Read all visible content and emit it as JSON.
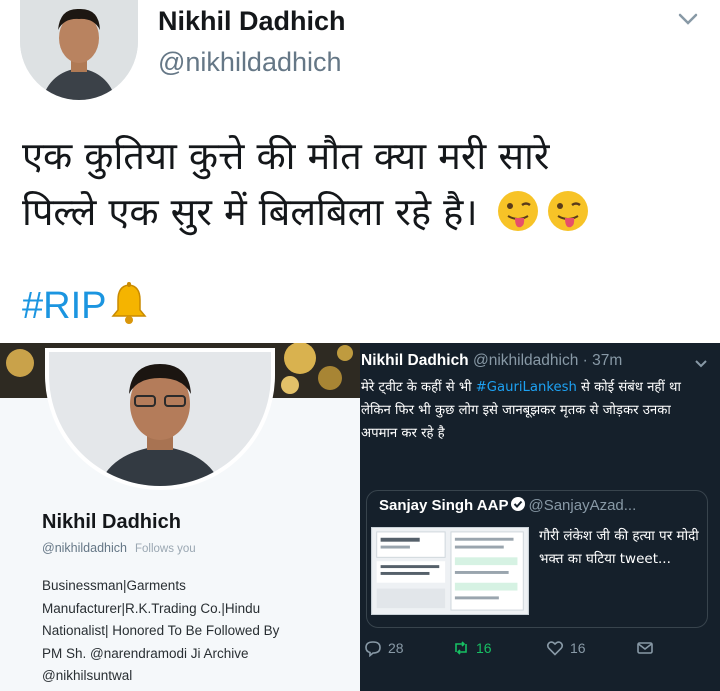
{
  "top_tweet": {
    "name": "Nikhil Dadhich",
    "handle": "@nikhildadhich",
    "text_line1": "एक कुतिया कुत्ते की मौत क्या मरी सारे",
    "text_line2": "पिल्ले एक सुर में बिलबिला रहे है।",
    "hashtag": "#RIP",
    "icons": [
      "chevron-down-icon",
      "tongue-out-emoji-icon",
      "bell-icon"
    ]
  },
  "profile": {
    "name": "Nikhil Dadhich",
    "handle": "@nikhildadhich",
    "follows_you": "Follows you",
    "bio_lines": [
      "Businessman|Garments",
      "Manufacturer|R.K.Trading Co.|Hindu",
      "Nationalist| Honored To Be Followed By",
      "PM Sh. @narendramodi Ji Archive",
      "@nikhilsuntwal"
    ]
  },
  "dark_tweet": {
    "name": "Nikhil Dadhich",
    "handle_time": "@nikhildadhich · 37m",
    "text_before_tag": "मेरे ट्वीट के कहीं से भी ",
    "tag": "#GauriLankesh",
    "text_after_tag": " से कोई संबंध नहीं था लेकिन फिर भी कुछ लोग इसे जानबूझकर मृतक से जोड़कर उनका अपमान कर रहे है",
    "quote": {
      "name": "Sanjay Singh AAP",
      "handle": "@SanjayAzad...",
      "text": "गौरी लंकेश जी की हत्या पर मोदी भक्त का घटिया tweet..."
    },
    "actions": {
      "replies": "28",
      "retweets": "16",
      "likes": "16"
    },
    "colors": {
      "background": "#15202b",
      "link": "#1da1f2",
      "retweet": "#17bf63"
    }
  }
}
